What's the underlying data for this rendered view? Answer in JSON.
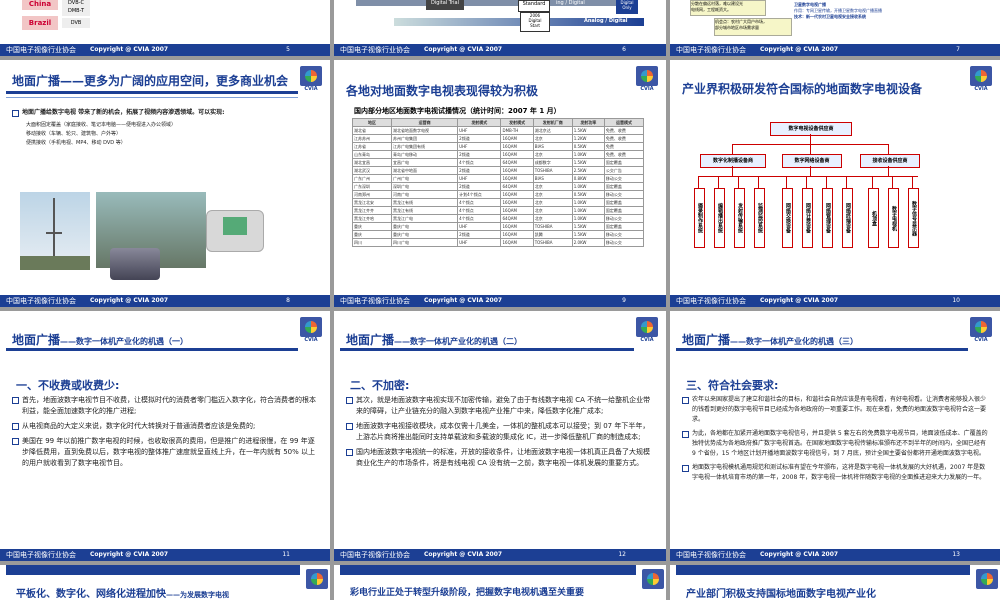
{
  "footer": {
    "org": "中国电子视像行业协会",
    "copyright": "Copyright @ CVIA 2007"
  },
  "logo": {
    "text": "CVIA"
  },
  "slides": {
    "s5": {
      "page": "5",
      "china": "China",
      "brazil": "Brazil",
      "dvbc": "DVB-C",
      "dmbt": "DMB-T",
      "dvb": "DVB"
    },
    "s6": {
      "page": "6",
      "trial": "Digital Trial",
      "standard": "Standard",
      "digital": "Digital",
      "year": "2006",
      "start": "Start",
      "only": "Only",
      "analog": "Analog / Digital",
      "ngdig": "ing / Digital"
    },
    "s7": {
      "page": "7",
      "l1": "卫星数字电视广播",
      "l2": "作用：专网卫星传输，开播卫星数字电视广播直播",
      "l3": "技术：新一代农村卫星电视安全接收系统",
      "c1": "分散在偏远村落，难以建设光",
      "c2": "电线网，工程耗资大。",
      "c3": "机会点：农村广大用户市场，",
      "c4": "部分城市地区市场需求量"
    },
    "s8": {
      "page": "8",
      "title": "地面广播——更多为广阔的应用空间，更多商业机会",
      "lead": "地面广播给数字电视 带来了新的机会，拓展了视频内容渗透领域。可以实现:",
      "b1": "大面积固定覆盖（家庭接收、笔记本电脑——便电视进入办公领域）",
      "b2": "移动接收（车辆、轮只、建筑物、户外等）",
      "b3": "便携接收（手机电视、MP4、移动 DVD 等）"
    },
    "s9": {
      "page": "9",
      "title": "各地对地面数字电视表现得较为积极",
      "subtitle": "国内部分地区地面数字电视试播情况（统计时间：2007 年 1 月）",
      "headers": [
        "地区",
        "运营商",
        "发射模式",
        "发射模式",
        "发射机厂商",
        "发射功率",
        "运营模式"
      ],
      "rows": [
        [
          "湖北省",
          "湖北省地面数字电视",
          "UHF",
          "DMB-TH",
          "湖北京达",
          "1.5KW",
          "免费、收费"
        ],
        [
          "江苏苏州",
          "苏州广电集团",
          "2频道",
          "16QAM",
          "北京",
          "1.2KW",
          "免费、收费"
        ],
        [
          "江苏省",
          "江苏广电集团有线",
          "UHF",
          "16QAM",
          "BIAS",
          "0.5KW",
          "免费"
        ],
        [
          "山东青岛",
          "青岛广电移动",
          "2频道",
          "16QAM",
          "北京",
          "1.0KW",
          "免费、收费"
        ],
        [
          "湖北宜昌",
          "宜昌广电",
          "4个频点",
          "64QAM",
          "成都数字",
          "1.5KW",
          "固定覆盖"
        ],
        [
          "湖北武汉",
          "湖北省中地面",
          "2频道",
          "16QAM",
          "TOSHIBA",
          "2.5KW",
          "公交广告"
        ],
        [
          "广东广州",
          "广州广电",
          "UHF",
          "16QAM",
          "BIAS",
          "0.8KW",
          "移动公交"
        ],
        [
          "广东深圳",
          "深圳广电",
          "2频道",
          "64QAM",
          "北京",
          "1.0KW",
          "固定覆盖"
        ],
        [
          "河南郑州",
          "河南广电",
          "计划4个频点",
          "16QAM",
          "北京",
          "0.5KW",
          "移动公交"
        ],
        [
          "黑龙江北安",
          "黑龙江有线",
          "4个频点",
          "16QAM",
          "北京",
          "1.0KW",
          "固定覆盖"
        ],
        [
          "黑龙江齐齐",
          "黑龙江有线",
          "4个频点",
          "16QAM",
          "北京",
          "1.0KW",
          "固定覆盖"
        ],
        [
          "黑龙江齐哈",
          "黑龙江广电",
          "4个频点",
          "64QAM",
          "北京",
          "1.0KW",
          "移动公交"
        ],
        [
          "重庆",
          "重庆广电",
          "UHF",
          "16QAM",
          "TOSHIBA",
          "1.5KW",
          "固定覆盖"
        ],
        [
          "重庆",
          "重庆广电",
          "2频道",
          "16QAM",
          "凯腾",
          "1.5KW",
          "移动公交"
        ],
        [
          "四川",
          "四川广电",
          "UHF",
          "16QAM",
          "TOSHIBA",
          "2.0KW",
          "移动公交"
        ]
      ]
    },
    "s10": {
      "page": "10",
      "title": "产业界积极研发符合国标的地面数字电视设备",
      "root": "数字电视设备供应商",
      "m1": "数字化制播设备商",
      "m2": "数字网络设备商",
      "m3": "接收设备供应商",
      "leaves": [
        "摄录制作系统",
        "编辑播出系统",
        "发射传输系统",
        "监测监控系统",
        "网络交换设备",
        "网络计费设备",
        "网络管理设备",
        "网络终端设备",
        "机顶盒",
        "数字电视机",
        "数字信号显示器"
      ]
    },
    "s11": {
      "page": "11",
      "title": "地面广播",
      "subtitle": "——数字一体机产业化的机遇（一）",
      "sec": "一、不收费或收费少:",
      "p": [
        "首先，地面波数字电视节目不收费，让模拟时代的消费者零门槛迈入数字化，符合消费者的根本利益，能全面加速数字化的推广进程;",
        "从电视商品的大定义来说，数字化时代大转换对于普通消费者应该是免费的;",
        "美国在 99 年以前推广数字电视的时候，也收取很高的费用，但是推广的进程很慢，在 99 年逐步降低费用，直到免费以后，数字电视的整体推广速度就呈直线上升，在一年内就有 50% 以上的用户就收看到了数字电视节目。"
      ]
    },
    "s12": {
      "page": "12",
      "title": "地面广播",
      "subtitle": "——数字一体机产业化的机遇（二）",
      "sec": "二、不加密:",
      "p": [
        "其次，就是地面波数字电视实现不加密传输，避免了由于有线数字电视 CA 不统一给整机企业带来的障碍，让产业链充分的融入到数字电视产业推广中来，降低数字化推广成本;",
        "地面波数字电视接收模块，成本仅需十几美金，一体机的整机成本可以接受；到 07 年下半年，上游芯片商将推出能同时支持单载波和多载波的集成化 IC，进一步降低整机厂商的制造成本;",
        "国内地面波数字电视统一的标准，开放的接收条件，让地面波数字电视一体机真正具备了大规模商业化生产的市场条件，将是有线电视 CA 没有统一之前，数字电视一体机发展的重要方式。"
      ]
    },
    "s13": {
      "page": "13",
      "title": "地面广播",
      "subtitle": "——数字一体机产业化的机遇（三）",
      "sec": "三、符合社会要求:",
      "p": [
        "农年以来国家提出了建立和谐社会的目标，和谐社会自然应该是有电视看，有好电视看。让消费者能够投入很少的钱看到更好的数字电视节目已经成为各地政府的一项重要工作。现在来看，免费的地面波数字电视符合这一要求。",
        "为此，各地都在加紧开通地面数字电视信号，并且提供 5 套左右的免费数字电视节目，地面波低成本、广覆盖的独特优势成为各地政府推广数字电视首选。在国家地面数字电视传输标准颁布还不到半年的时间内，全国已经有 9 个省份，15 个地区计划开播地面波数字电视信号，到 7 月底，预计全国主要省份都将开通地面波数字电视。",
        "地面数字电视模机通用规范和测试标准有望在今年颁布，这将是数字电视一体机发展的大好机遇，2007 年是数字电视一体机培育市场的第一年，2008 年，数字电视一体机将伴随数字电视的全面推进迎来大力发展的一年。"
      ]
    },
    "s14": {
      "title": "平板化、数字化、网络化进程加快",
      "subtitle": "——为发展数字电视"
    },
    "s15": {
      "title": "彩电行业正处于转型升级阶段，把握数字电视机遇至关重要"
    },
    "s16": {
      "title": "产业部门积极支持国标地面数字电视产业化"
    }
  }
}
